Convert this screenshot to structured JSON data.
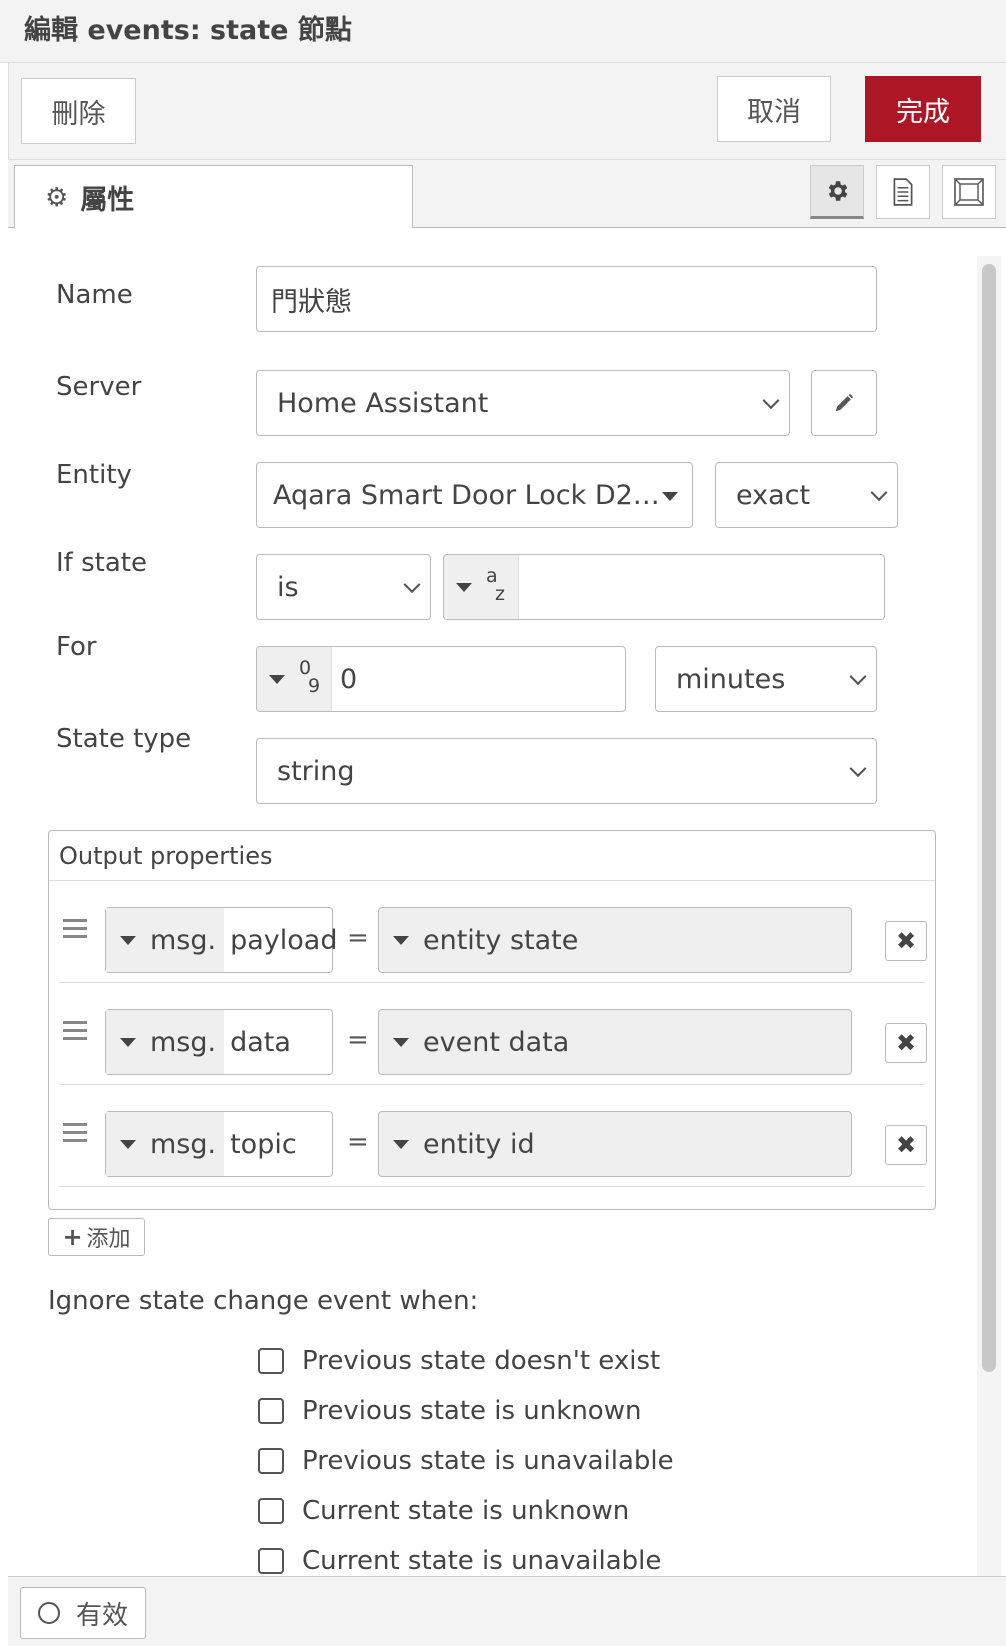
{
  "dialog": {
    "title": "編輯 events: state 節點"
  },
  "toolbar": {
    "delete_label": "刪除",
    "cancel_label": "取消",
    "done_label": "完成",
    "done_color": "#ad1625"
  },
  "tabs": {
    "properties_label": "屬性"
  },
  "form": {
    "name": {
      "label": "Name",
      "value": "門狀態"
    },
    "server": {
      "label": "Server",
      "value": "Home Assistant"
    },
    "entity": {
      "label": "Entity",
      "value": "Aqara Smart Door Lock D2…",
      "match": "exact"
    },
    "if_state": {
      "label": "If state",
      "operator": "is",
      "type_glyph_top": "a",
      "type_glyph_bottom": "z",
      "value": ""
    },
    "for": {
      "label": "For",
      "type_glyph_top": "0",
      "type_glyph_bottom": "9",
      "value": "0",
      "unit": "minutes"
    },
    "state_type": {
      "label": "State type",
      "value": "string"
    }
  },
  "output": {
    "header": "Output properties",
    "rows": [
      {
        "prefix": "msg.",
        "property": "payload",
        "equals": "=",
        "value": "entity state"
      },
      {
        "prefix": "msg.",
        "property": "data",
        "equals": "=",
        "value": "event data"
      },
      {
        "prefix": "msg.",
        "property": "topic",
        "equals": "=",
        "value": "entity id"
      }
    ],
    "add_label": "添加"
  },
  "ignore": {
    "label": "Ignore state change event when:",
    "options": [
      {
        "label": "Previous state doesn't exist",
        "checked": false
      },
      {
        "label": "Previous state is unknown",
        "checked": false
      },
      {
        "label": "Previous state is unavailable",
        "checked": false
      },
      {
        "label": "Current state is unknown",
        "checked": false
      },
      {
        "label": "Current state is unavailable",
        "checked": false
      }
    ]
  },
  "footer": {
    "enabled_label": "有效"
  }
}
